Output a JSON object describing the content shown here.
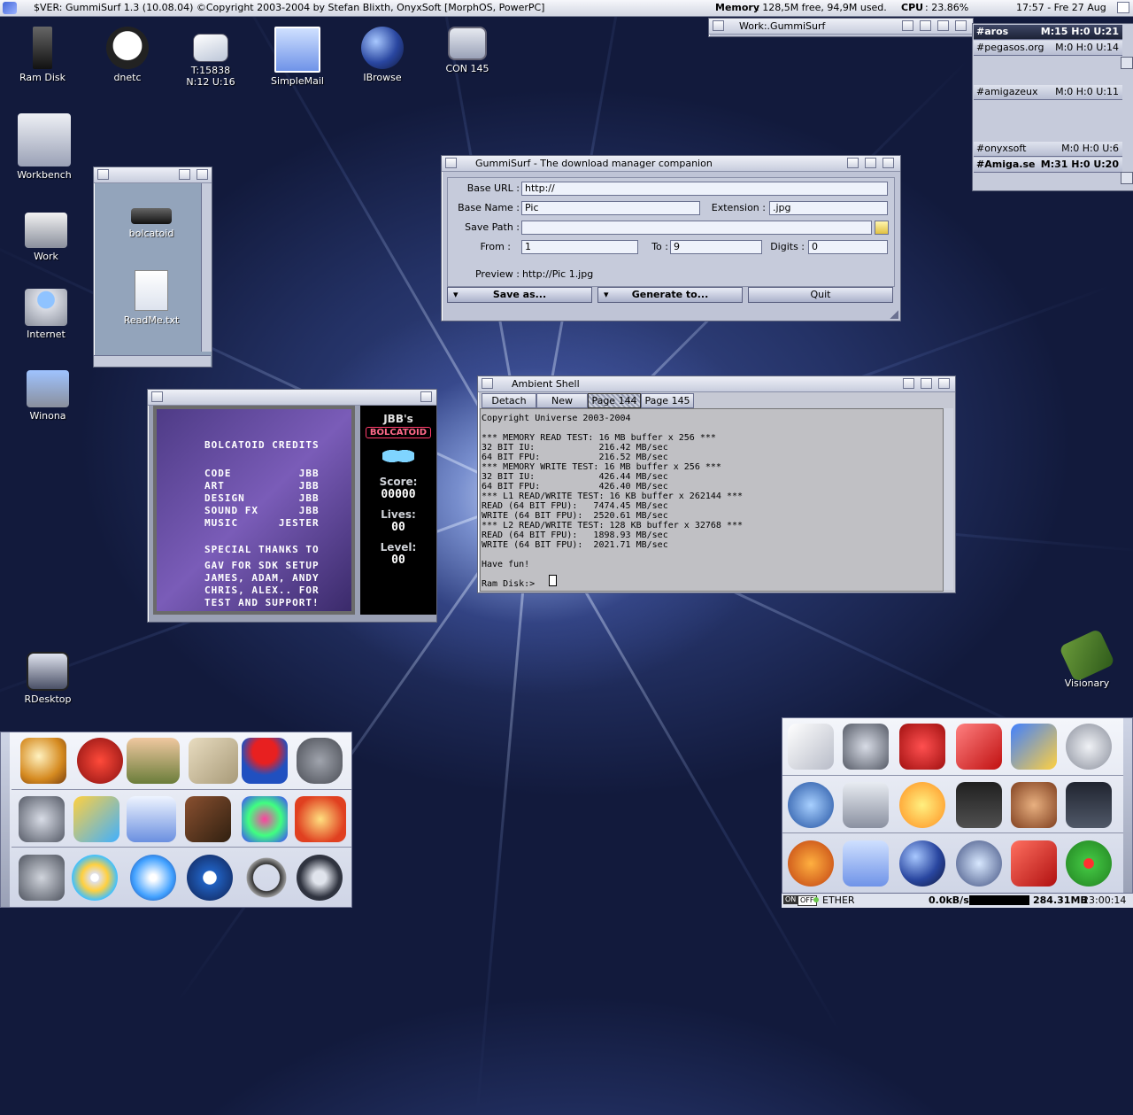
{
  "screen": {
    "title": "$VER: GummiSurf 1.3 (10.08.04) ©Copyright 2003-2004 by Stefan Blixth, OnyxSoft [MorphOS, PowerPC]",
    "memory_label": "Memory",
    "memory_value": ": 128,5M free, 94,9M used.",
    "cpu_label": "CPU",
    "cpu_value": ": 23.86%",
    "clock": "17:57 - Fre 27 Aug"
  },
  "desktop_icons": [
    {
      "label": "Ram Disk"
    },
    {
      "label": "dnetc"
    },
    {
      "label": "T:15838 N:12 U:16"
    },
    {
      "label": "SimpleMail"
    },
    {
      "label": "IBrowse"
    },
    {
      "label": "CON 145"
    },
    {
      "label": "Workbench"
    },
    {
      "label": "Work"
    },
    {
      "label": "Internet"
    },
    {
      "label": "Winona"
    },
    {
      "label": "RDesktop"
    },
    {
      "label": "Visionary"
    }
  ],
  "work_window": {
    "title": "Work:.GummiSurf"
  },
  "drawer_window": {
    "items": [
      {
        "label": "bolcatoid"
      },
      {
        "label": "ReadMe.txt"
      }
    ]
  },
  "gummisurf": {
    "title": "GummiSurf - The download manager companion",
    "base_url_label": "Base URL :",
    "base_url_value": "http://",
    "base_name_label": "Base Name :",
    "base_name_value": "Pic",
    "extension_label": "Extension :",
    "extension_value": ".jpg",
    "save_path_label": "Save Path :",
    "save_path_value": "",
    "from_label": "From :",
    "from_value": "1",
    "to_label": "To :",
    "to_value": "9",
    "digits_label": "Digits :",
    "digits_value": "0",
    "preview_label": "Preview :",
    "preview_value": "http://Pic 1.jpg",
    "save_as_label": "Save as...",
    "generate_label": "Generate to...",
    "quit_label": "Quit"
  },
  "shell": {
    "title": "Ambient Shell",
    "tabs": [
      "Detach",
      "New",
      "Page 144",
      "Page 145"
    ],
    "output": "Copyright Universe 2003-2004\n\n*** MEMORY READ TEST: 16 MB buffer x 256 ***\n32 BIT IU:            216.42 MB/sec\n64 BIT FPU:           216.52 MB/sec\n*** MEMORY WRITE TEST: 16 MB buffer x 256 ***\n32 BIT IU:            426.44 MB/sec\n64 BIT FPU:           426.40 MB/sec\n*** L1 READ/WRITE TEST: 16 KB buffer x 262144 ***\nREAD (64 BIT FPU):   7474.45 MB/sec\nWRITE (64 BIT FPU):  2520.61 MB/sec\n*** L2 READ/WRITE TEST: 128 KB buffer x 32768 ***\nREAD (64 BIT FPU):   1898.93 MB/sec\nWRITE (64 BIT FPU):  2021.71 MB/sec\n\nHave fun!\n\nRam Disk:>"
  },
  "game": {
    "credits_title": "BOLCATOID CREDITS",
    "credits": [
      "CODE          JBB",
      "ART           JBB",
      "DESIGN        JBB",
      "SOUND FX      JBB",
      "MUSIC      JESTER"
    ],
    "thanks": [
      "SPECIAL THANKS TO",
      "GAV FOR SDK SETUP",
      "JAMES, ADAM, ANDY",
      "CHRIS, ALEX.. FOR",
      "TEST AND SUPPORT!"
    ],
    "logo_top": "JBB's",
    "score_label": "Score:",
    "score_value": "00000",
    "lives_label": "Lives:",
    "lives_value": "00",
    "level_label": "Level:",
    "level_value": "00"
  },
  "irc": [
    {
      "channel": "#aros",
      "stats": "M:15 H:0 U:21"
    },
    {
      "channel": "#pegasos.org",
      "stats": "M:0 H:0 U:14"
    },
    {
      "channel": "#amigazeux",
      "stats": "M:0 H:0 U:11"
    },
    {
      "channel": "#onyxsoft",
      "stats": "M:0 H:0 U:6"
    },
    {
      "channel": "#Amiga.se",
      "stats": "M:31 H:0 U:20"
    }
  ],
  "statusbar": {
    "on": "ON",
    "off": "OFF",
    "iface": "ETHER",
    "rate": "0.0kB/s",
    "free": "284.31MB",
    "time": "23:00:14"
  },
  "game_logo": "BOLCATOID",
  "colors": {
    "accent": "#5b6fd6",
    "panel": "#bfc4d6"
  }
}
